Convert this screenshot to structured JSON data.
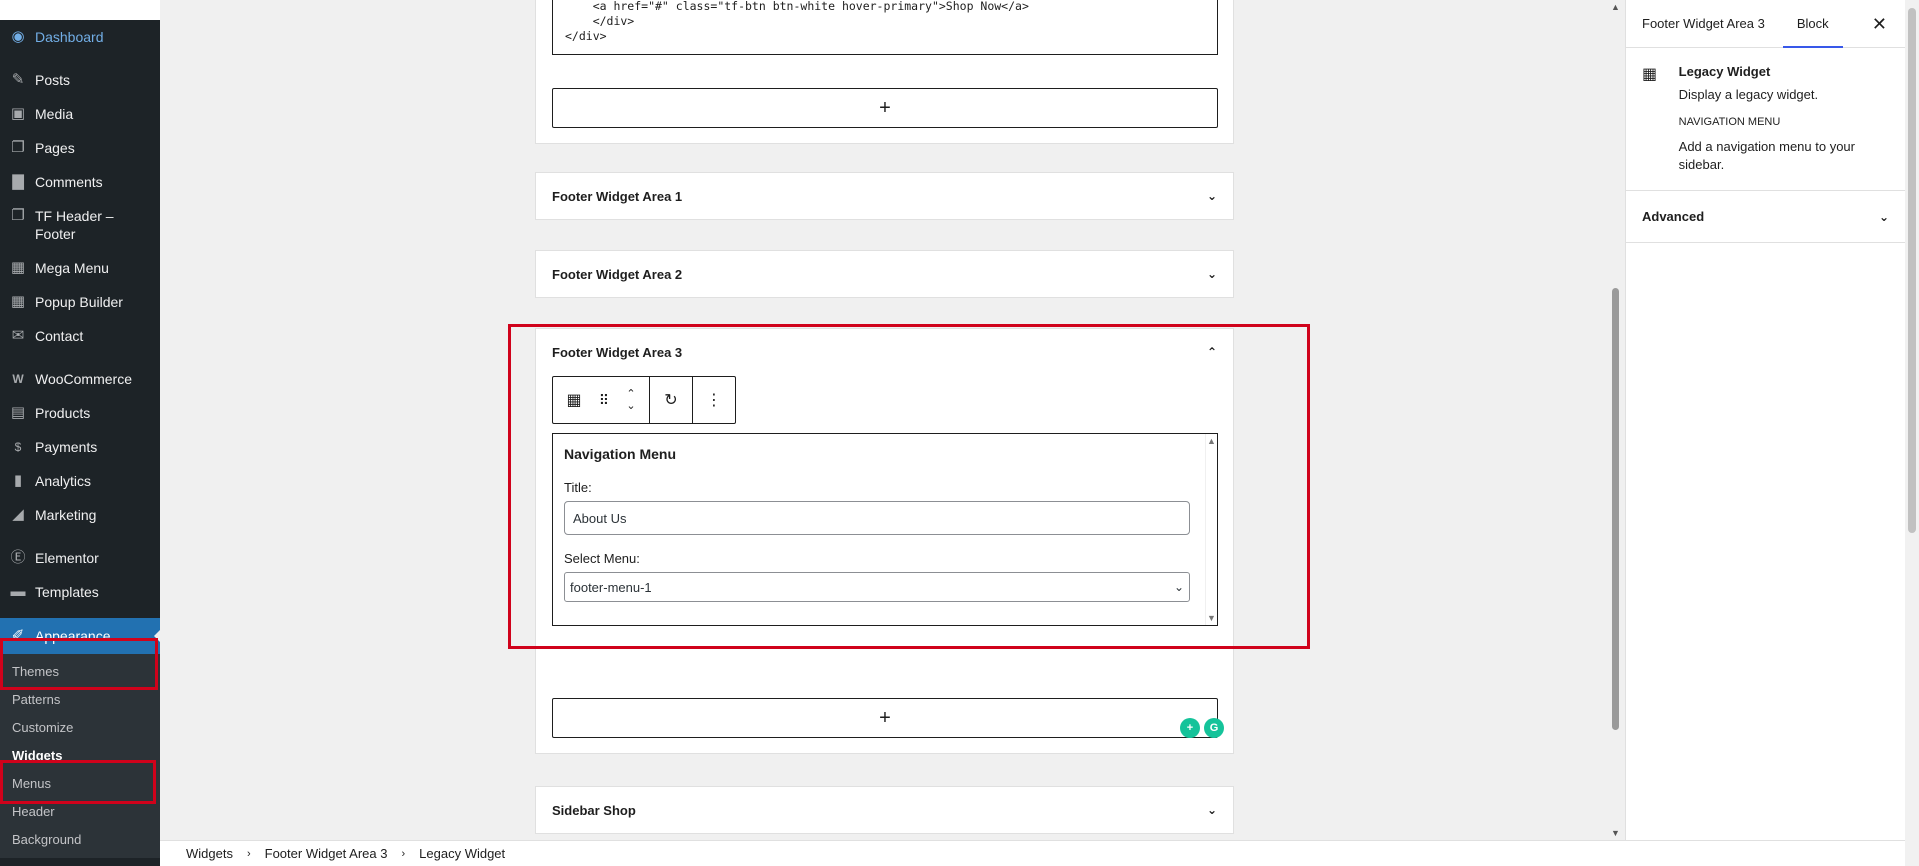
{
  "sidebar": {
    "items": [
      {
        "label": "Dashboard",
        "icon": "dashboard-icon"
      },
      {
        "label": "Posts",
        "icon": "pin-icon"
      },
      {
        "label": "Media",
        "icon": "media-icon"
      },
      {
        "label": "Pages",
        "icon": "pages-icon"
      },
      {
        "label": "Comments",
        "icon": "comment-icon"
      },
      {
        "label": "TF Header – Footer",
        "icon": "pages-icon"
      },
      {
        "label": "Mega Menu",
        "icon": "grid-icon"
      },
      {
        "label": "Popup Builder",
        "icon": "grid-icon"
      },
      {
        "label": "Contact",
        "icon": "mail-icon"
      },
      {
        "label": "WooCommerce",
        "icon": "woo-icon"
      },
      {
        "label": "Products",
        "icon": "archive-icon"
      },
      {
        "label": "Payments",
        "icon": "dollar-icon"
      },
      {
        "label": "Analytics",
        "icon": "bar-chart-icon"
      },
      {
        "label": "Marketing",
        "icon": "megaphone-icon"
      },
      {
        "label": "Elementor",
        "icon": "elementor-icon"
      },
      {
        "label": "Templates",
        "icon": "folder-icon"
      },
      {
        "label": "Appearance",
        "icon": "paintbrush-icon"
      }
    ],
    "submenu": [
      "Themes",
      "Patterns",
      "Customize",
      "Widgets",
      "Menus",
      "Header",
      "Background"
    ]
  },
  "canvas": {
    "code_lines": [
      "    <a href=\"#\" class=\"tf-btn btn-white hover-primary\">Shop Now</a>",
      "    </div>",
      "</div>"
    ],
    "add_symbol": "+",
    "areas": {
      "fwa1": "Footer Widget Area 1",
      "fwa2": "Footer Widget Area 2",
      "fwa3": "Footer Widget Area 3",
      "sidebar_shop": "Sidebar Shop"
    },
    "widget": {
      "title": "Navigation Menu",
      "title_label": "Title:",
      "title_value": "About Us",
      "menu_label": "Select Menu:",
      "menu_value": "footer-menu-1"
    }
  },
  "inspector": {
    "tab_area": "Footer Widget Area 3",
    "tab_block": "Block",
    "block_name": "Legacy Widget",
    "block_desc": "Display a legacy widget.",
    "widget_heading": "NAVIGATION MENU",
    "widget_desc": "Add a navigation menu to your sidebar.",
    "advanced": "Advanced"
  },
  "breadcrumb": [
    "Widgets",
    "Footer Widget Area 3",
    "Legacy Widget"
  ],
  "colors": {
    "admin_bg": "#1d2327",
    "accent": "#2271b1",
    "highlight": "#d0021b",
    "tab_underline": "#3858e9"
  }
}
